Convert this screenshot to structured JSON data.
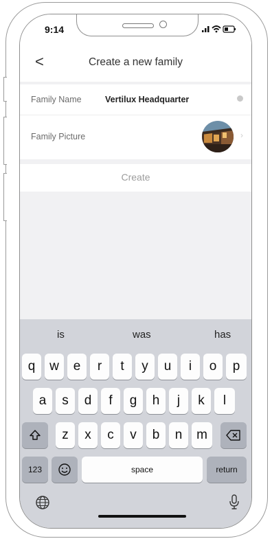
{
  "status": {
    "time": "9:14"
  },
  "nav": {
    "back_glyph": "<",
    "title": "Create a new family"
  },
  "form": {
    "family_name_label": "Family Name",
    "family_name_value": "Vertilux Headquarter",
    "family_picture_label": "Family Picture",
    "create_label": "Create"
  },
  "keyboard": {
    "suggestions": [
      "is",
      "was",
      "has"
    ],
    "row1": [
      "q",
      "w",
      "e",
      "r",
      "t",
      "y",
      "u",
      "i",
      "o",
      "p"
    ],
    "row2": [
      "a",
      "s",
      "d",
      "f",
      "g",
      "h",
      "j",
      "k",
      "l"
    ],
    "row3": [
      "z",
      "x",
      "c",
      "v",
      "b",
      "n",
      "m"
    ],
    "numbers_label": "123",
    "space_label": "space",
    "return_label": "return"
  },
  "icons": {
    "shift": "shift-icon",
    "delete": "backspace-icon",
    "emoji": "emoji-icon",
    "globe": "globe-icon",
    "mic": "microphone-icon"
  }
}
